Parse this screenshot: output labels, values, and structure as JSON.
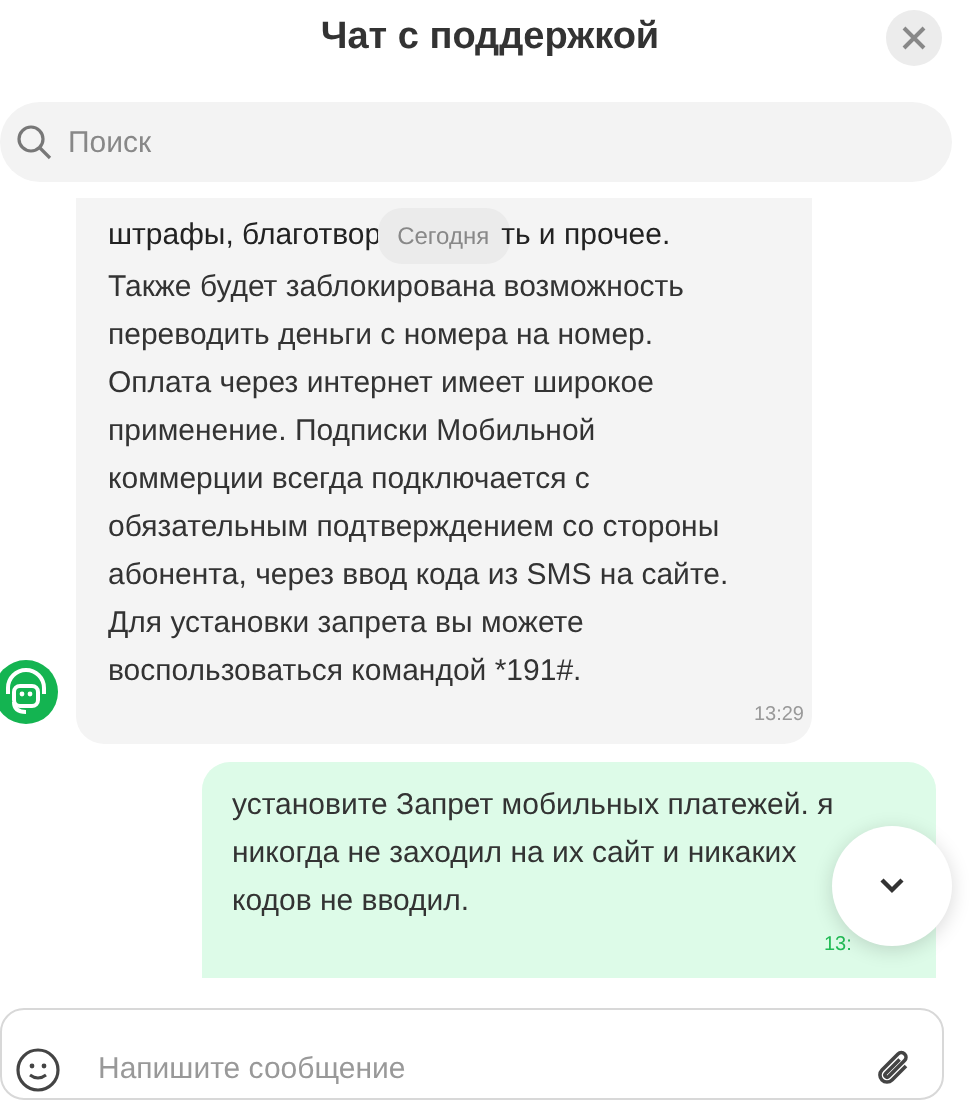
{
  "header": {
    "title": "Чат с поддержкой"
  },
  "search": {
    "placeholder": "Поиск"
  },
  "messages": [
    {
      "kind": "incoming",
      "first_line": {
        "before": "штрафы, благотвор",
        "after": "ть и прочее."
      },
      "date_pill": "Сегодня",
      "lines": [
        "Также будет заблокирована возможность",
        "переводить деньги с номера на номер.",
        "Оплата через интернет имеет широкое",
        "применение. Подписки Мобильной",
        "коммерции всегда подключается с",
        "обязательным подтверждением со стороны",
        "абонента, через ввод кода из SMS на сайте.",
        "Для установки запрета вы можете",
        "воспользоваться командой *191#."
      ],
      "time": "13:29"
    },
    {
      "kind": "outgoing",
      "lines": [
        "установите Запрет мобильных платежей. я",
        "никогда не заходил на их сайт и никаких",
        "кодов не вводил."
      ],
      "time": "13:"
    }
  ],
  "composer": {
    "placeholder": "Напишите сообщение"
  }
}
